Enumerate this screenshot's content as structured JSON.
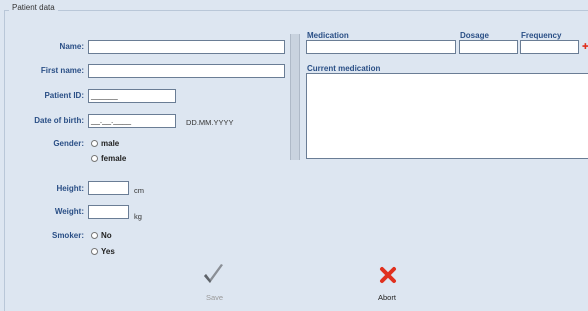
{
  "group_title": "Patient data",
  "labels": {
    "name": "Name:",
    "first_name": "First name:",
    "patient_id": "Patient ID:",
    "date_of_birth": "Date of birth:",
    "gender": "Gender:",
    "height": "Height:",
    "weight": "Weight:",
    "smoker": "Smoker:"
  },
  "fields": {
    "patient_id_mask": "______",
    "date_of_birth_mask": "__.__.____",
    "date_format_hint": "DD.MM.YYYY",
    "height_unit": "cm",
    "weight_unit": "kg"
  },
  "gender_options": [
    "male",
    "female"
  ],
  "smoker_options": [
    "No",
    "Yes"
  ],
  "medication": {
    "col_medication": "Medication",
    "col_dosage": "Dosage",
    "col_frequency": "Frequency",
    "current_medication": "Current medication"
  },
  "actions": {
    "save": "Save",
    "abort": "Abort"
  },
  "colors": {
    "label_blue": "#2a4f86",
    "abort_red": "#e0301e",
    "save_disabled": "#7a7a7a"
  }
}
